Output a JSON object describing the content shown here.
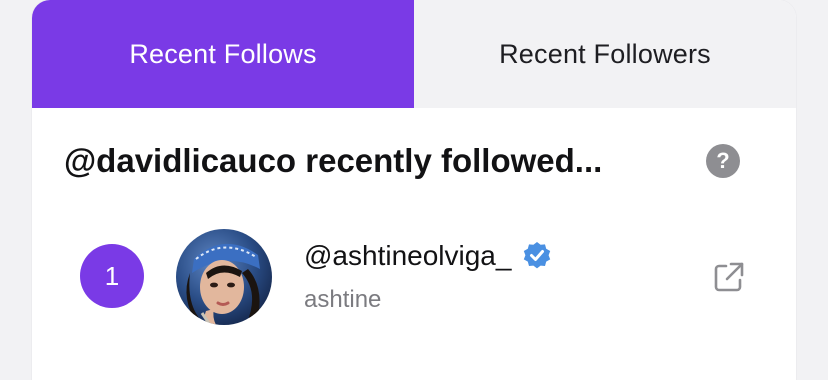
{
  "tabs": [
    {
      "label": "Recent Follows",
      "active": true
    },
    {
      "label": "Recent Followers",
      "active": false
    }
  ],
  "heading": "@davidlicauco recently followed...",
  "help_icon": {
    "glyph": "?",
    "icon": "help-icon"
  },
  "entries": [
    {
      "rank": "1",
      "handle": "@ashtineolviga_",
      "display_name": "ashtine",
      "verified": true
    }
  ],
  "colors": {
    "accent": "#7a3ae6",
    "verified": "#4a90e2",
    "muted": "#7b7b80"
  }
}
